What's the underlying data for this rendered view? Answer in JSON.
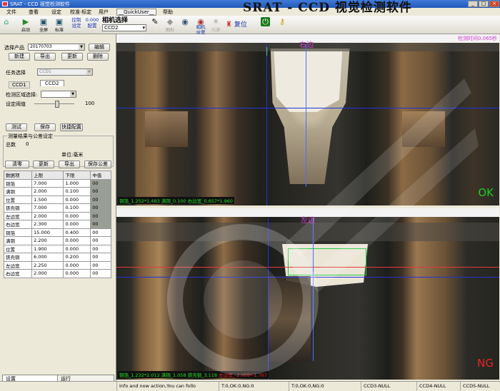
{
  "window": {
    "title": "SRAT - CCD 视觉检测软件",
    "banner": "SRAT - CCD 视觉检测软件"
  },
  "menu": [
    "文件",
    "查看",
    "设定",
    "校准·标定",
    "用户",
    "__QuickUser__",
    "帮助"
  ],
  "toolbar": {
    "start": "启动",
    "fullscreen": "全屏",
    "standard": "标准",
    "control_settings": "控制\n设定",
    "config_value": "0.000",
    "config_label": "配置",
    "camera_select_label": "相机选择",
    "camera_select_value": "CCD2",
    "graphic_setup": "图形设置",
    "camera_settings": "相机\n设置",
    "light_source": "光源",
    "reset": "复位"
  },
  "left": {
    "product_label": "选择产品",
    "product_value": "20170703",
    "edit": "编辑",
    "new": "新建",
    "export": "导出",
    "update": "更新",
    "delete": "删除",
    "task_label": "任务选择",
    "task_value": "CCD1",
    "ccd_tabs": [
      "CCD1",
      "CCD2"
    ],
    "region_label": "检测区域选择:",
    "threshold_label": "设定阈值",
    "threshold_value": "100",
    "test": "测试",
    "save": "保存",
    "quick_config": "快捷配置",
    "group_title": "测量结果与公差设定",
    "total_label": "总数",
    "total_value": "0",
    "unit": "单位:毫米",
    "clear": "清零",
    "update2": "更新",
    "export2": "导出",
    "save_tolerance": "保存公差",
    "table_headers": [
      "数据项",
      "上限",
      "下限",
      "中值"
    ],
    "table_rows": [
      [
        "铜箔",
        "7.000",
        "1.000",
        "00"
      ],
      [
        "满铜",
        "2.000",
        "0.100",
        "00"
      ],
      [
        "位置",
        "1.500",
        "0.000",
        "00"
      ],
      [
        "铁壳铜",
        "7.000",
        "0.100",
        "00"
      ],
      [
        "左边宽",
        "2.000",
        "0.000",
        "00"
      ],
      [
        "右边宽",
        "2.300",
        "0.000",
        "00"
      ],
      [
        "铜箔",
        "15.000",
        "0.400",
        "00"
      ],
      [
        "满铜",
        "2.200",
        "0.000",
        "00"
      ],
      [
        "位置",
        "1.900",
        "0.000",
        "00"
      ],
      [
        "铁壳铜",
        "6.000",
        "0.200",
        "00"
      ],
      [
        "左边宽",
        "2.250",
        "0.000",
        "00"
      ],
      [
        "右边宽",
        "2.000",
        "0.000",
        "00"
      ]
    ],
    "bottom_tabs": [
      "设置",
      "运行"
    ]
  },
  "view1": {
    "title": "右边",
    "detect_time": "检测时间0.065秒",
    "result": "OK",
    "measure": "铜箔_1.252*1.483 满铜_0.100 右边宽_0.657*1.960"
  },
  "view2": {
    "title": "左边",
    "result": "NG",
    "measure_ok": "铜箔_1.232*2.012 满铜_1.058 铁壳铜_3.118",
    "measure_ng": "左边宽_-2.009*-1.767"
  },
  "statusbar": [
    "info and now action,You can follo",
    "T:0,OK:0,NG:0",
    "T:0,OK:0,NG:0",
    "CCD3-NULL",
    "CCD4-NULL",
    "CCD5-NULL"
  ],
  "colors": {
    "ok": "#22cc22",
    "ng": "#ee2222",
    "panel_title": "#d03cd0",
    "gray_cell": "#9a9f95"
  }
}
